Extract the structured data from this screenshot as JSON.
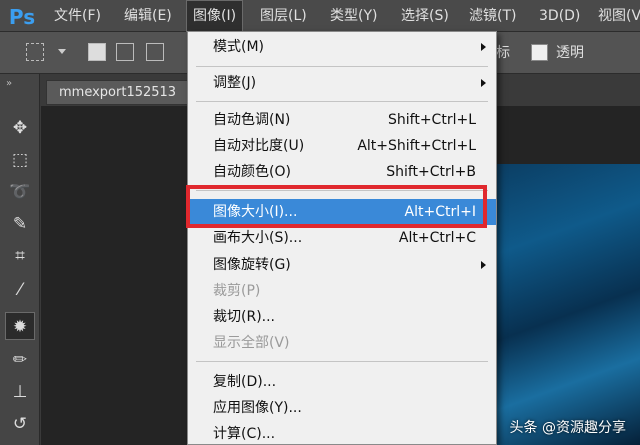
{
  "app": {
    "logo": "Ps"
  },
  "menubar": {
    "items": [
      {
        "label": "文件(F)"
      },
      {
        "label": "编辑(E)"
      },
      {
        "label": "图像(I)"
      },
      {
        "label": "图层(L)"
      },
      {
        "label": "类型(Y)"
      },
      {
        "label": "选择(S)"
      },
      {
        "label": "滤镜(T)"
      },
      {
        "label": "3D(D)"
      },
      {
        "label": "视图(V)"
      }
    ],
    "active_item": "图像(I)"
  },
  "options_bar": {
    "partial_label": "标",
    "transparent_label": "透明",
    "transparent_checked": false
  },
  "document": {
    "tab_title": "mmexport152513"
  },
  "tools": [
    {
      "icon": "move-tool-icon"
    },
    {
      "icon": "marquee-tool-icon"
    },
    {
      "icon": "lasso-tool-icon"
    },
    {
      "icon": "quick-selection-tool-icon"
    },
    {
      "icon": "crop-tool-icon"
    },
    {
      "icon": "eyedropper-tool-icon"
    },
    {
      "icon": "healing-brush-tool-icon",
      "selected": true
    },
    {
      "icon": "brush-tool-icon"
    },
    {
      "icon": "clone-stamp-tool-icon"
    },
    {
      "icon": "history-brush-tool-icon"
    }
  ],
  "image_menu": {
    "items": [
      {
        "label": "模式(M)",
        "shortcut": "",
        "submenu": true
      },
      {
        "label": "调整(J)",
        "shortcut": "",
        "submenu": true
      },
      {
        "label": "自动色调(N)",
        "shortcut": "Shift+Ctrl+L"
      },
      {
        "label": "自动对比度(U)",
        "shortcut": "Alt+Shift+Ctrl+L"
      },
      {
        "label": "自动颜色(O)",
        "shortcut": "Shift+Ctrl+B"
      },
      {
        "label": "图像大小(I)...",
        "shortcut": "Alt+Ctrl+I",
        "highlighted": true
      },
      {
        "label": "画布大小(S)...",
        "shortcut": "Alt+Ctrl+C"
      },
      {
        "label": "图像旋转(G)",
        "shortcut": "",
        "submenu": true
      },
      {
        "label": "裁剪(P)",
        "shortcut": "",
        "disabled": true
      },
      {
        "label": "裁切(R)...",
        "shortcut": ""
      },
      {
        "label": "显示全部(V)",
        "shortcut": "",
        "disabled": true
      },
      {
        "label": "复制(D)...",
        "shortcut": ""
      },
      {
        "label": "应用图像(Y)...",
        "shortcut": ""
      },
      {
        "label": "计算(C)...",
        "shortcut": ""
      }
    ]
  },
  "watermark": "头条 @资源趣分享",
  "colors": {
    "highlight": "#3a89d8",
    "annotation_box": "#e0282e",
    "logo": "#3b9ef0"
  }
}
